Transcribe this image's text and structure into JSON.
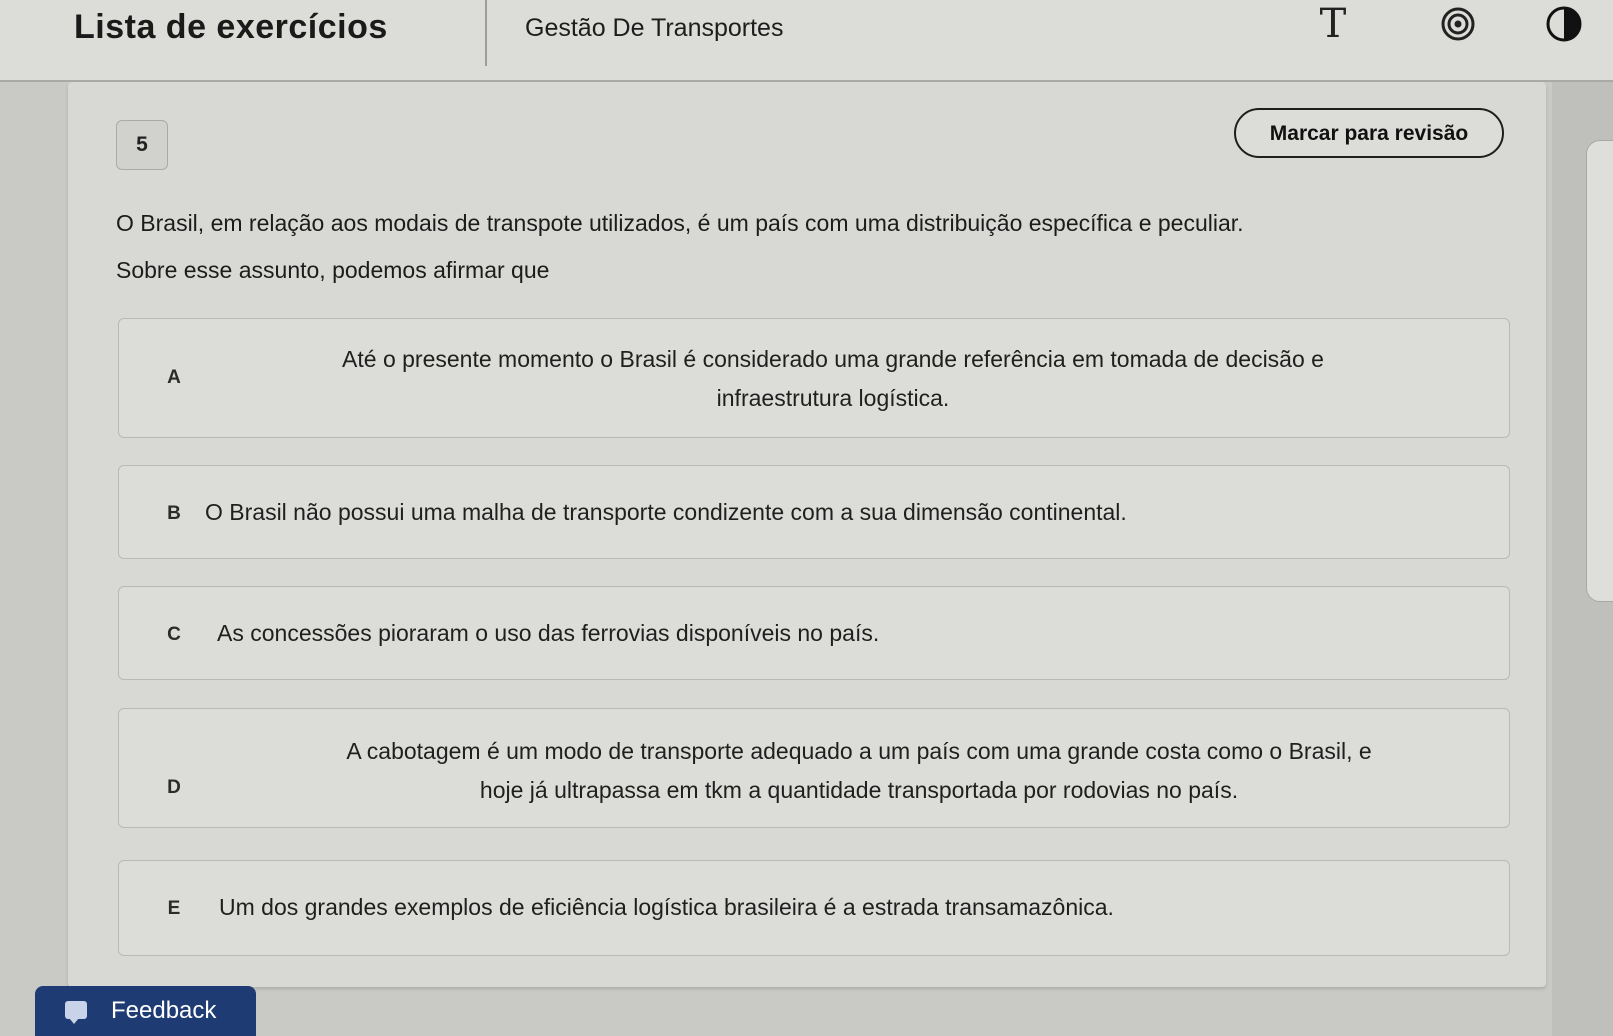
{
  "header": {
    "app_title": "Lista de exercícios",
    "course_title": "Gestão De Transportes",
    "icons": [
      "font-size-icon",
      "target-icon",
      "contrast-icon"
    ]
  },
  "question": {
    "number": "5",
    "review_label": "Marcar para revisão",
    "prompt_lines": [
      "O Brasil, em relação aos modais de transpote utilizados, é um país com uma distribuição específica e peculiar.",
      "Sobre esse assunto, podemos afirmar que"
    ],
    "options": [
      {
        "letter": "A",
        "lines": [
          "Até o presente momento o Brasil é considerado uma grande referência em tomada de decisão e",
          "infraestrutura logística."
        ]
      },
      {
        "letter": "B",
        "lines": [
          "O Brasil não possui uma malha de transporte condizente com a sua dimensão continental."
        ]
      },
      {
        "letter": "C",
        "lines": [
          "As concessões pioraram o uso das ferrovias disponíveis no país."
        ]
      },
      {
        "letter": "D",
        "lines": [
          "A cabotagem é um modo de transporte adequado a um país com uma grande costa como o Brasil, e",
          "hoje já ultrapassa em tkm a quantidade transportada por rodovias no país."
        ]
      },
      {
        "letter": "E",
        "lines": [
          "Um dos grandes exemplos de eficiência logística brasileira é a estrada transamazônica."
        ]
      }
    ]
  },
  "feedback": {
    "label": "Feedback"
  },
  "colors": {
    "feedback_bg": "#1e3b73",
    "panel_bg": "#d8d8d4"
  }
}
